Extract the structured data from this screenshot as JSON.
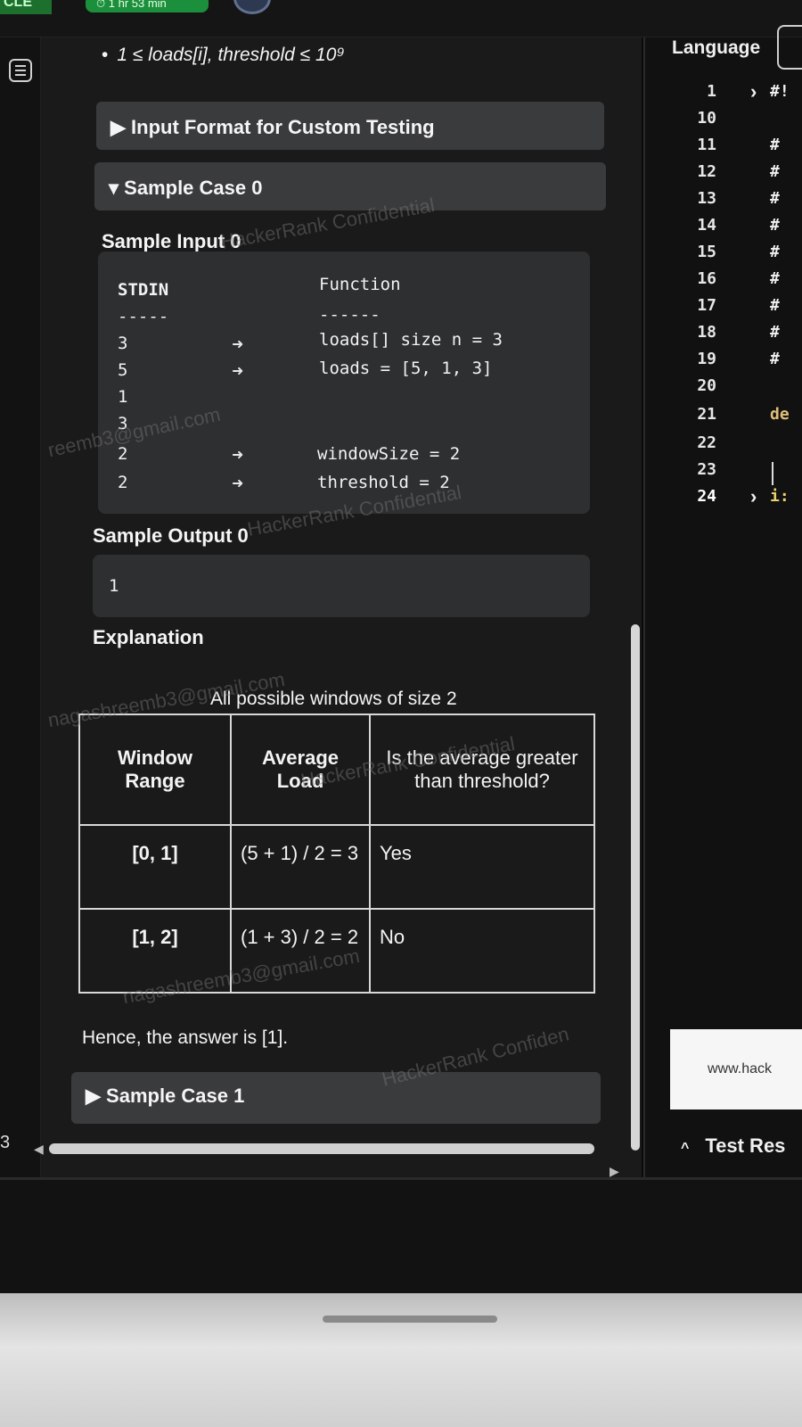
{
  "top": {
    "brand": "CLE",
    "timer": "⏱ 1 hr 53 min"
  },
  "problem": {
    "constraint_bullet": "1 ≤ loads[i], threshold ≤ 10⁹",
    "custom_testing_label": "▶ Input Format for Custom Testing",
    "sample0_label": "▾ Sample Case 0",
    "sample_input_heading": "Sample Input 0",
    "stdin_header": "STDIN",
    "function_header": "Function",
    "stdin_sep": "-----",
    "function_sep": "------",
    "stdin_values": [
      "3",
      "5",
      "1",
      "3",
      "2",
      "2"
    ],
    "function_lines": [
      "loads[] size n = 3",
      "loads = [5, 1, 3]",
      "windowSize = 2",
      "threshold = 2"
    ],
    "sample_output_heading": "Sample Output 0",
    "sample_output_value": "1",
    "explanation_heading": "Explanation",
    "table_caption": "All possible windows of size 2",
    "table_headers": [
      "Window Range",
      "Average Load",
      "Is the average greater than threshold?"
    ],
    "table_rows": [
      [
        "[0, 1]",
        "(5 + 1) / 2 = 3",
        "Yes"
      ],
      [
        "[1, 2]",
        "(1 + 3) / 2 = 2",
        "No"
      ]
    ],
    "conclusion": "Hence, the answer is [1].",
    "sample1_label": "▶ Sample Case 1",
    "rail_number": "3"
  },
  "watermarks": [
    "HackerRank Confidential",
    "reemb3@gmail.com",
    "HackerRank Confidential",
    "nagashreemb3@gmail.com",
    "HackerRank Confidential",
    "nagashreemb3@gmail.com",
    "HackerRank Confiden"
  ],
  "editor": {
    "language_label": "Language",
    "line_numbers": [
      "1",
      "10",
      "11",
      "12",
      "13",
      "14",
      "15",
      "16",
      "17",
      "18",
      "19",
      "20",
      "21",
      "22",
      "23",
      "24"
    ],
    "line1_code": "#!",
    "hash_lines": [
      "#",
      "#",
      "#",
      "#",
      "#",
      "#",
      "#",
      "#",
      "#"
    ],
    "line21_code": "de",
    "line24_code": "i:",
    "url_text": "www.hack",
    "test_results_label": "Test Res"
  }
}
